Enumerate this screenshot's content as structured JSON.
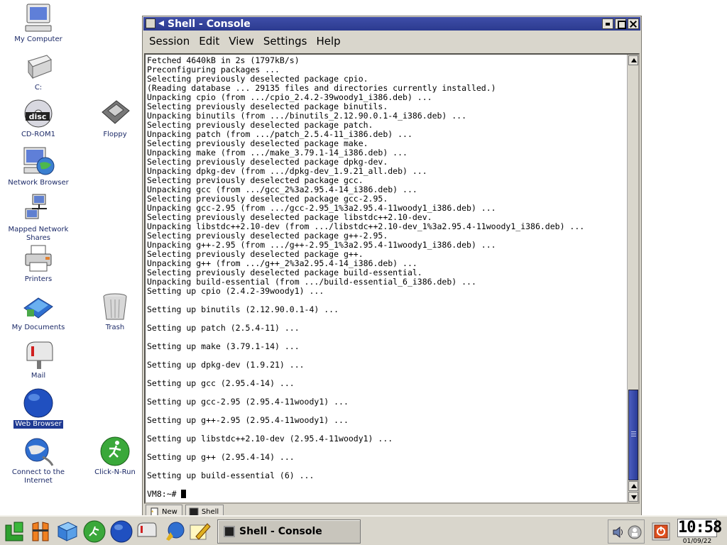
{
  "desktop": {
    "icons": [
      {
        "label": "My Computer"
      },
      {
        "label": "C:"
      },
      {
        "label": "CD-ROM1"
      },
      {
        "label": "Floppy"
      },
      {
        "label": "Network Browser"
      },
      {
        "label": "Mapped Network Shares"
      },
      {
        "label": "Printers"
      },
      {
        "label": "My Documents"
      },
      {
        "label": "Trash"
      },
      {
        "label": "Mail"
      },
      {
        "label": "Web Browser"
      },
      {
        "label": "Connect to the Internet"
      },
      {
        "label": "Click-N-Run"
      }
    ],
    "selected_icon": "Web Browser"
  },
  "window": {
    "title": "Shell - Console",
    "menu": [
      "Session",
      "Edit",
      "View",
      "Settings",
      "Help"
    ],
    "terminal_lines": [
      "Fetched 4640kB in 2s (1797kB/s)",
      "Preconfiguring packages ...",
      "Selecting previously deselected package cpio.",
      "(Reading database ... 29135 files and directories currently installed.)",
      "Unpacking cpio (from .../cpio_2.4.2-39woody1_i386.deb) ...",
      "Selecting previously deselected package binutils.",
      "Unpacking binutils (from .../binutils_2.12.90.0.1-4_i386.deb) ...",
      "Selecting previously deselected package patch.",
      "Unpacking patch (from .../patch_2.5.4-11_i386.deb) ...",
      "Selecting previously deselected package make.",
      "Unpacking make (from .../make_3.79.1-14_i386.deb) ...",
      "Selecting previously deselected package dpkg-dev.",
      "Unpacking dpkg-dev (from .../dpkg-dev_1.9.21_all.deb) ...",
      "Selecting previously deselected package gcc.",
      "Unpacking gcc (from .../gcc_2%3a2.95.4-14_i386.deb) ...",
      "Selecting previously deselected package gcc-2.95.",
      "Unpacking gcc-2.95 (from .../gcc-2.95_1%3a2.95.4-11woody1_i386.deb) ...",
      "Selecting previously deselected package libstdc++2.10-dev.",
      "Unpacking libstdc++2.10-dev (from .../libstdc++2.10-dev_1%3a2.95.4-11woody1_i386.deb) ...",
      "Selecting previously deselected package g++-2.95.",
      "Unpacking g++-2.95 (from .../g++-2.95_1%3a2.95.4-11woody1_i386.deb) ...",
      "Selecting previously deselected package g++.",
      "Unpacking g++ (from .../g++_2%3a2.95.4-14_i386.deb) ...",
      "Selecting previously deselected package build-essential.",
      "Unpacking build-essential (from .../build-essential_6_i386.deb) ...",
      "Setting up cpio (2.4.2-39woody1) ...",
      "",
      "Setting up binutils (2.12.90.0.1-4) ...",
      "",
      "Setting up patch (2.5.4-11) ...",
      "",
      "Setting up make (3.79.1-14) ...",
      "",
      "Setting up dpkg-dev (1.9.21) ...",
      "",
      "Setting up gcc (2.95.4-14) ...",
      "",
      "Setting up gcc-2.95 (2.95.4-11woody1) ...",
      "",
      "Setting up g++-2.95 (2.95.4-11woody1) ...",
      "",
      "Setting up libstdc++2.10-dev (2.95.4-11woody1) ...",
      "",
      "Setting up g++ (2.95.4-14) ...",
      "",
      "Setting up build-essential (6) ...",
      ""
    ],
    "prompt": "VM8:~# ",
    "tabs": [
      "New",
      "Shell"
    ]
  },
  "taskbar": {
    "task_label": "Shell - Console",
    "clock_time": "10:58",
    "clock_date": "01/09/22"
  },
  "colors": {
    "titlebar": "#2b3a8f",
    "desktop_label": "#1c2a68",
    "scroll_thumb": "#3a4cb0"
  }
}
